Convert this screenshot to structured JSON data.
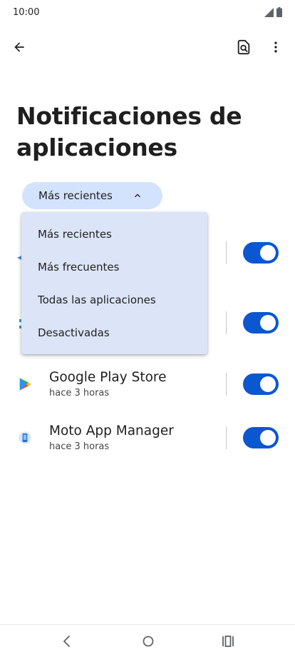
{
  "status_bar": {
    "time": "10:00"
  },
  "header": {
    "back_icon": "arrow-left-icon",
    "search_icon": "search-settings-icon",
    "more_icon": "more-vert-icon"
  },
  "page": {
    "title": "Notificaciones de aplicaciones"
  },
  "filter": {
    "selected_label": "Más recientes",
    "expanded": true
  },
  "dropdown": {
    "options": [
      "Más recientes",
      "Más frecuentes",
      "Todas las aplicaciones",
      "Desactivadas"
    ]
  },
  "apps": [
    {
      "name": "",
      "time": "",
      "enabled": true
    },
    {
      "name": "",
      "time": "",
      "enabled": true
    },
    {
      "name": "Google Play Store",
      "time": "hace 3 horas",
      "enabled": true,
      "icon": "google-play-icon"
    },
    {
      "name": "Moto App Manager",
      "time": "hace 3 horas",
      "enabled": true,
      "icon": "moto-app-manager-icon"
    }
  ],
  "colors": {
    "accent": "#0b57d0",
    "chip_background": "#d3e3fd",
    "menu_background": "#dce5f7"
  }
}
